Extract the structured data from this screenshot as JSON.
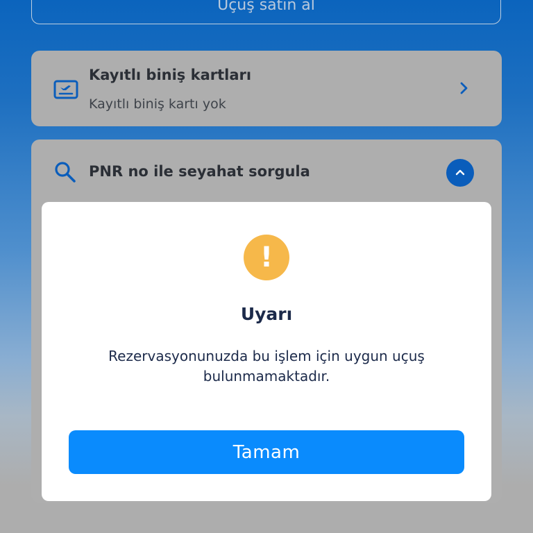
{
  "top_button": {
    "label": "Uçuş satın al"
  },
  "boarding_cards": {
    "title": "Kayıtlı biniş kartları",
    "subtitle": "Kayıtlı biniş kartı yok",
    "icon": "boarding-pass-icon"
  },
  "pnr_section": {
    "title": "PNR no ile seyahat sorgula",
    "icon": "search-icon",
    "toggle_icon": "chevron-up-icon"
  },
  "modal": {
    "icon": "warning-icon",
    "icon_glyph": "!",
    "title": "Uyarı",
    "message": "Rezervasyonunuzda bu işlem için uygun uçuş bulunmamaktadır.",
    "ok_label": "Tamam"
  },
  "colors": {
    "primary_blue": "#0a5dbb",
    "button_blue": "#0a8bfd",
    "warning_orange": "#f6b84a",
    "text_dark": "#1c2a4a"
  }
}
